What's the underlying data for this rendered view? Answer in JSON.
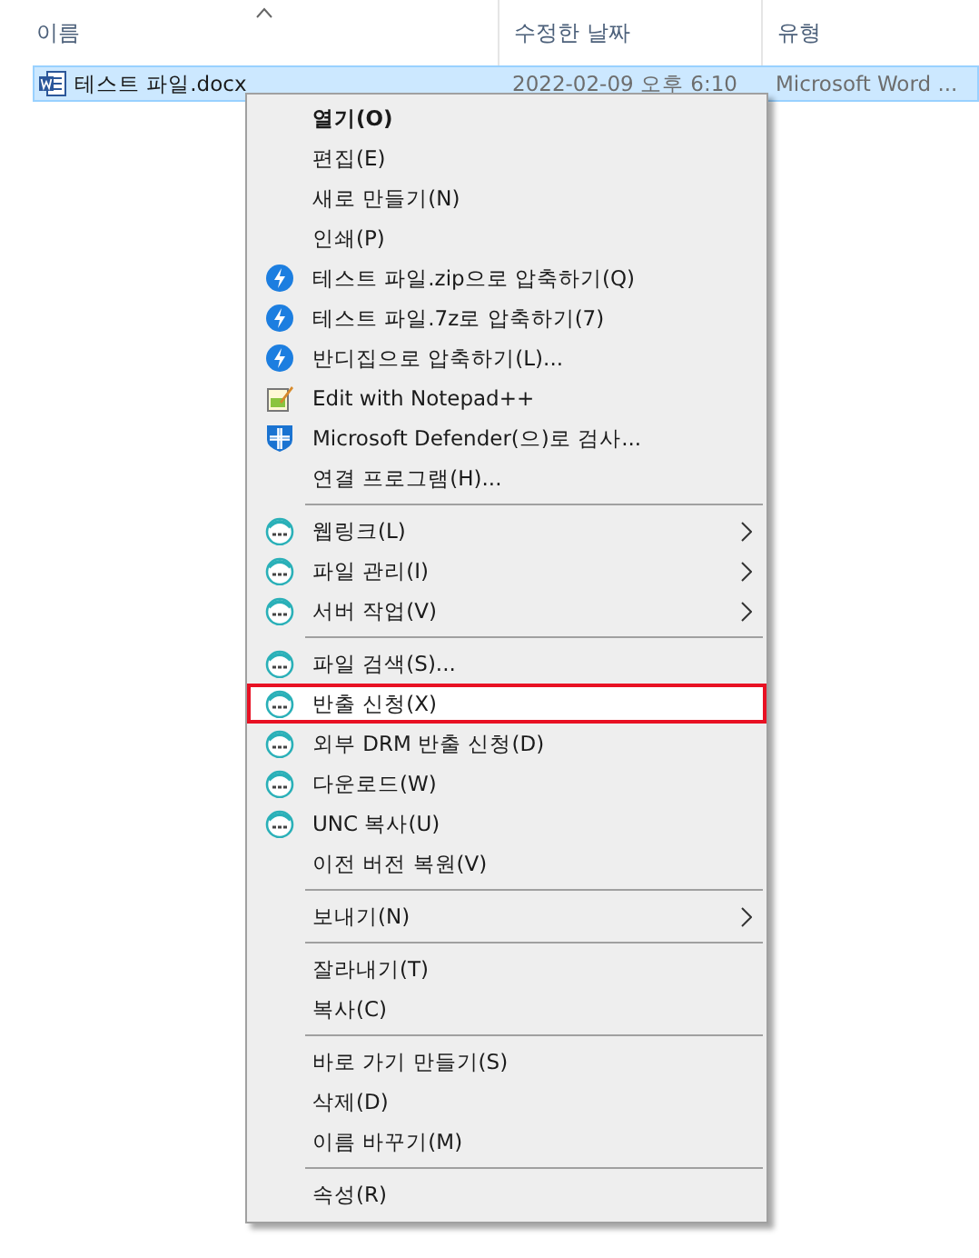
{
  "columns": [
    {
      "label": "이름",
      "sorted": true
    },
    {
      "label": "수정한 날짜",
      "sorted": false
    },
    {
      "label": "유형",
      "sorted": false
    }
  ],
  "file": {
    "name": "테스트 파일.docx",
    "date": "2022-02-09 오후 6:10",
    "type": "Microsoft Word ...",
    "selected": true
  },
  "menu": [
    {
      "kind": "plain",
      "label": "열기(O)",
      "bold": true,
      "submenu": false,
      "selected": false
    },
    {
      "kind": "plain",
      "label": "편집(E)",
      "bold": false,
      "submenu": false,
      "selected": false
    },
    {
      "kind": "plain",
      "label": "새로 만들기(N)",
      "bold": false,
      "submenu": false,
      "selected": false
    },
    {
      "kind": "plain",
      "label": "인쇄(P)",
      "bold": false,
      "submenu": false,
      "selected": false
    },
    {
      "kind": "zip",
      "label": "테스트 파일.zip으로 압축하기(Q)",
      "bold": false,
      "submenu": false,
      "selected": false
    },
    {
      "kind": "zip",
      "label": "테스트 파일.7z로 압축하기(7)",
      "bold": false,
      "submenu": false,
      "selected": false
    },
    {
      "kind": "zip",
      "label": "반디집으로 압축하기(L)...",
      "bold": false,
      "submenu": false,
      "selected": false
    },
    {
      "kind": "notepad",
      "label": "Edit with Notepad++",
      "bold": false,
      "submenu": false,
      "selected": false
    },
    {
      "kind": "defender",
      "label": "Microsoft Defender(으)로 검사...",
      "bold": false,
      "submenu": false,
      "selected": false
    },
    {
      "kind": "plain",
      "label": "연결 프로그램(H)...",
      "bold": false,
      "submenu": false,
      "selected": false
    },
    {
      "kind": "separator"
    },
    {
      "kind": "doc",
      "label": "웹링크(L)",
      "bold": false,
      "submenu": true,
      "selected": false
    },
    {
      "kind": "doc",
      "label": "파일 관리(I)",
      "bold": false,
      "submenu": true,
      "selected": false
    },
    {
      "kind": "doc",
      "label": "서버 작업(V)",
      "bold": false,
      "submenu": true,
      "selected": false
    },
    {
      "kind": "separator"
    },
    {
      "kind": "doc",
      "label": "파일 검색(S)...",
      "bold": false,
      "submenu": false,
      "selected": false
    },
    {
      "kind": "doc",
      "label": "반출 신청(X)",
      "bold": false,
      "submenu": false,
      "selected": true
    },
    {
      "kind": "doc",
      "label": "외부 DRM 반출 신청(D)",
      "bold": false,
      "submenu": false,
      "selected": false
    },
    {
      "kind": "doc",
      "label": "다운로드(W)",
      "bold": false,
      "submenu": false,
      "selected": false
    },
    {
      "kind": "doc",
      "label": "UNC 복사(U)",
      "bold": false,
      "submenu": false,
      "selected": false
    },
    {
      "kind": "plain",
      "label": "이전 버전 복원(V)",
      "bold": false,
      "submenu": false,
      "selected": false
    },
    {
      "kind": "separator"
    },
    {
      "kind": "plain",
      "label": "보내기(N)",
      "bold": false,
      "submenu": true,
      "selected": false
    },
    {
      "kind": "separator"
    },
    {
      "kind": "plain",
      "label": "잘라내기(T)",
      "bold": false,
      "submenu": false,
      "selected": false
    },
    {
      "kind": "plain",
      "label": "복사(C)",
      "bold": false,
      "submenu": false,
      "selected": false
    },
    {
      "kind": "separator"
    },
    {
      "kind": "plain",
      "label": "바로 가기 만들기(S)",
      "bold": false,
      "submenu": false,
      "selected": false
    },
    {
      "kind": "plain",
      "label": "삭제(D)",
      "bold": false,
      "submenu": false,
      "selected": false
    },
    {
      "kind": "plain",
      "label": "이름 바꾸기(M)",
      "bold": false,
      "submenu": false,
      "selected": false
    },
    {
      "kind": "separator"
    },
    {
      "kind": "plain",
      "label": "속성(R)",
      "bold": false,
      "submenu": false,
      "selected": false
    }
  ]
}
